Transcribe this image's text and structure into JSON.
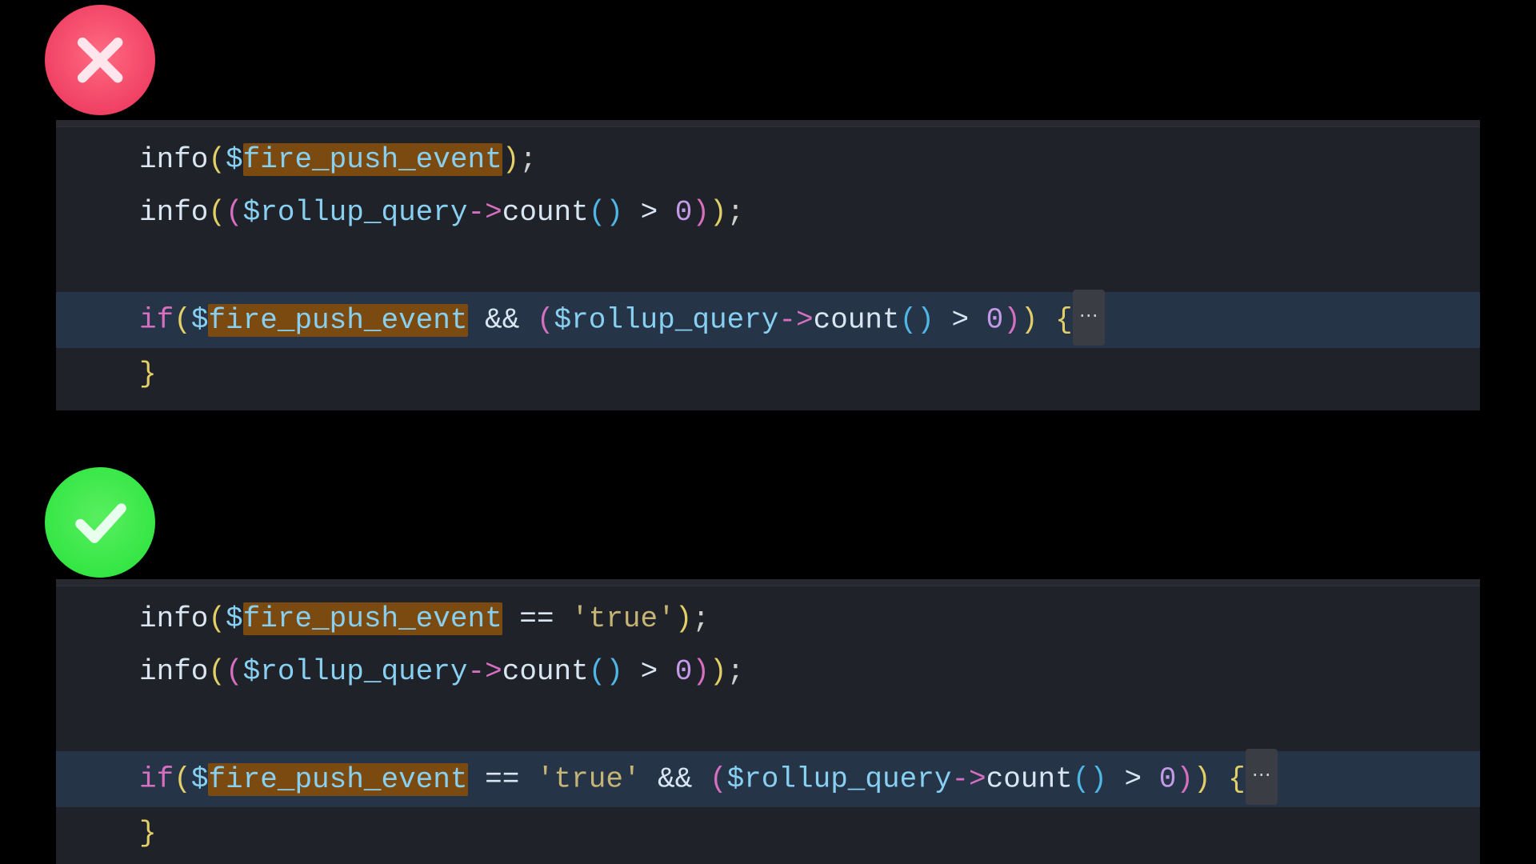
{
  "colors": {
    "background": "#000000",
    "editor_bg": "#1f2228",
    "row_highlight": "#263447",
    "match_highlight": "#7a4a10",
    "badge_wrong": "#ea2f57",
    "badge_right": "#25e23a",
    "token_function": "#d9e6f2",
    "token_variable": "#88d0f2",
    "token_keyword": "#d66fc0",
    "token_number": "#c39ae8",
    "token_string": "#c5b475",
    "token_brace_yellow": "#e3cf67",
    "token_brace_blue": "#4fb7e6"
  },
  "icons": {
    "wrong": "cross-icon",
    "right": "check-icon"
  },
  "fold_indicator": "⋯",
  "wrong": {
    "lines": [
      {
        "tokens": [
          {
            "text": "info",
            "cls": "t-fn"
          },
          {
            "text": "(",
            "cls": "t-yel"
          },
          {
            "text": "$",
            "cls": "t-var"
          },
          {
            "text": "fire_push_event",
            "cls": "t-var",
            "match": true
          },
          {
            "text": ")",
            "cls": "t-yel"
          },
          {
            "text": ";",
            "cls": "t-txt"
          }
        ]
      },
      {
        "tokens": [
          {
            "text": "info",
            "cls": "t-fn"
          },
          {
            "text": "(",
            "cls": "t-yel"
          },
          {
            "text": "(",
            "cls": "t-mag"
          },
          {
            "text": "$rollup_query",
            "cls": "t-var"
          },
          {
            "text": "->",
            "cls": "t-arr"
          },
          {
            "text": "count",
            "cls": "t-fn"
          },
          {
            "text": "(",
            "cls": "t-brc"
          },
          {
            "text": ")",
            "cls": "t-brc"
          },
          {
            "text": " > ",
            "cls": "t-def"
          },
          {
            "text": "0",
            "cls": "t-num"
          },
          {
            "text": ")",
            "cls": "t-mag"
          },
          {
            "text": ")",
            "cls": "t-yel"
          },
          {
            "text": ";",
            "cls": "t-txt"
          }
        ]
      },
      {
        "blank": true
      },
      {
        "highlight_row": true,
        "fold": true,
        "tokens": [
          {
            "text": "if",
            "cls": "t-kwd"
          },
          {
            "text": "(",
            "cls": "t-yel"
          },
          {
            "text": "$",
            "cls": "t-var"
          },
          {
            "text": "fire_push_event",
            "cls": "t-var",
            "match": true
          },
          {
            "text": " && ",
            "cls": "t-def"
          },
          {
            "text": "(",
            "cls": "t-mag"
          },
          {
            "text": "$rollup_query",
            "cls": "t-var"
          },
          {
            "text": "->",
            "cls": "t-arr"
          },
          {
            "text": "count",
            "cls": "t-fn"
          },
          {
            "text": "(",
            "cls": "t-brc"
          },
          {
            "text": ")",
            "cls": "t-brc"
          },
          {
            "text": " > ",
            "cls": "t-def"
          },
          {
            "text": "0",
            "cls": "t-num"
          },
          {
            "text": ")",
            "cls": "t-mag"
          },
          {
            "text": ")",
            "cls": "t-yel"
          },
          {
            "text": " {",
            "cls": "t-brcy"
          }
        ]
      },
      {
        "tokens": [
          {
            "text": "}",
            "cls": "t-brcy"
          }
        ]
      }
    ]
  },
  "right": {
    "lines": [
      {
        "tokens": [
          {
            "text": "info",
            "cls": "t-fn"
          },
          {
            "text": "(",
            "cls": "t-yel"
          },
          {
            "text": "$",
            "cls": "t-var"
          },
          {
            "text": "fire_push_event",
            "cls": "t-var",
            "match": true
          },
          {
            "text": " == ",
            "cls": "t-def"
          },
          {
            "text": "'true'",
            "cls": "t-str"
          },
          {
            "text": ")",
            "cls": "t-yel"
          },
          {
            "text": ";",
            "cls": "t-txt"
          }
        ]
      },
      {
        "tokens": [
          {
            "text": "info",
            "cls": "t-fn"
          },
          {
            "text": "(",
            "cls": "t-yel"
          },
          {
            "text": "(",
            "cls": "t-mag"
          },
          {
            "text": "$rollup_query",
            "cls": "t-var"
          },
          {
            "text": "->",
            "cls": "t-arr"
          },
          {
            "text": "count",
            "cls": "t-fn"
          },
          {
            "text": "(",
            "cls": "t-brc"
          },
          {
            "text": ")",
            "cls": "t-brc"
          },
          {
            "text": " > ",
            "cls": "t-def"
          },
          {
            "text": "0",
            "cls": "t-num"
          },
          {
            "text": ")",
            "cls": "t-mag"
          },
          {
            "text": ")",
            "cls": "t-yel"
          },
          {
            "text": ";",
            "cls": "t-txt"
          }
        ]
      },
      {
        "blank": true
      },
      {
        "highlight_row": true,
        "fold": true,
        "tokens": [
          {
            "text": "if",
            "cls": "t-kwd"
          },
          {
            "text": "(",
            "cls": "t-yel"
          },
          {
            "text": "$",
            "cls": "t-var"
          },
          {
            "text": "fire_push_event",
            "cls": "t-var",
            "match": true
          },
          {
            "text": " == ",
            "cls": "t-def"
          },
          {
            "text": "'true'",
            "cls": "t-str"
          },
          {
            "text": " && ",
            "cls": "t-def"
          },
          {
            "text": "(",
            "cls": "t-mag"
          },
          {
            "text": "$rollup_query",
            "cls": "t-var"
          },
          {
            "text": "->",
            "cls": "t-arr"
          },
          {
            "text": "count",
            "cls": "t-fn"
          },
          {
            "text": "(",
            "cls": "t-brc"
          },
          {
            "text": ")",
            "cls": "t-brc"
          },
          {
            "text": " > ",
            "cls": "t-def"
          },
          {
            "text": "0",
            "cls": "t-num"
          },
          {
            "text": ")",
            "cls": "t-mag"
          },
          {
            "text": ")",
            "cls": "t-yel"
          },
          {
            "text": " {",
            "cls": "t-brcy"
          }
        ]
      },
      {
        "tokens": [
          {
            "text": "}",
            "cls": "t-brcy"
          }
        ]
      }
    ]
  }
}
